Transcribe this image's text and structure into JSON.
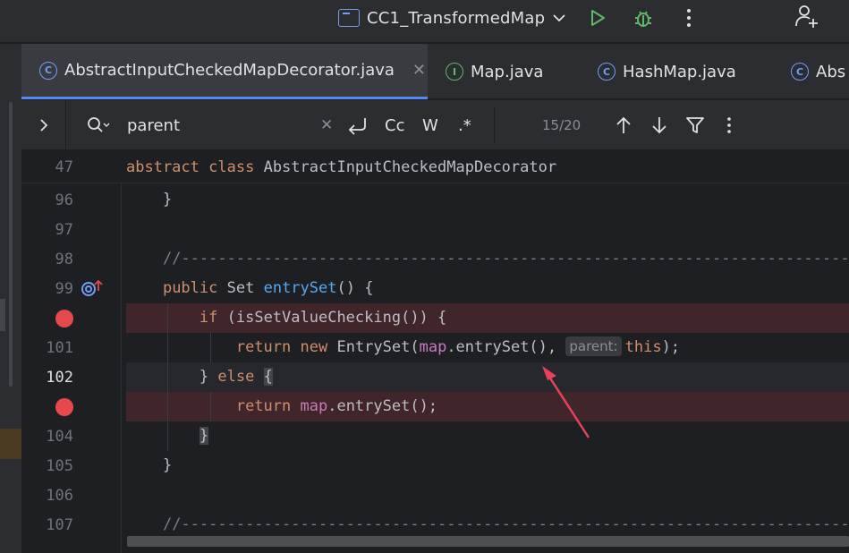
{
  "toolbar": {
    "run_config_label": "CC1_TransformedMap",
    "run_icon": "play-icon",
    "debug_icon": "bug-icon",
    "more_icon": "more-vertical-icon",
    "add_user_icon": "add-user-icon"
  },
  "tabs": [
    {
      "label": "AbstractInputCheckedMapDecorator.java",
      "icon": "C",
      "active": true
    },
    {
      "label": "Map.java",
      "icon": "I",
      "active": false
    },
    {
      "label": "HashMap.java",
      "icon": "C",
      "active": false
    },
    {
      "label": "Abs",
      "icon": "C",
      "active": false
    }
  ],
  "search": {
    "query": "parent",
    "match_case": "Cc",
    "words": "W",
    "regex": ".*",
    "count": "15/20"
  },
  "editor": {
    "sticky_line_number": "47",
    "sticky": {
      "kw1": "abstract",
      "kw2": "class",
      "name": "AbstractInputCheckedMapDecorator"
    },
    "line_numbers": [
      "96",
      "97",
      "98",
      "99",
      "101",
      "102",
      "104",
      "105",
      "106",
      "107"
    ],
    "lines": {
      "l96": "}",
      "l98": "//-------------------------------------------------------------------------------",
      "l99_kw": "public",
      "l99_type": "Set",
      "l99_fn": "entrySet",
      "l99_rest": "() {",
      "l100_kw": "if",
      "l100_rest": "(isSetValueChecking()) {",
      "l101_kw1": "return",
      "l101_kw2": "new",
      "l101_cls": "EntrySet(",
      "l101_field": "map",
      "l101_call": ".entrySet(), ",
      "l101_hint": "parent:",
      "l101_this": "this",
      "l101_end": ");",
      "l102_brace": "}",
      "l102_kw": "else",
      "l102_open": "{",
      "l103_kw": "return",
      "l103_field": "map",
      "l103_rest": ".entrySet();",
      "l104": "}",
      "l105": "}",
      "l107": "//-------------------------------------------------------------------------------"
    }
  },
  "colors": {
    "breakpoint": "#e5484d",
    "accent": "#548af7",
    "arrow": "#e8425a"
  }
}
